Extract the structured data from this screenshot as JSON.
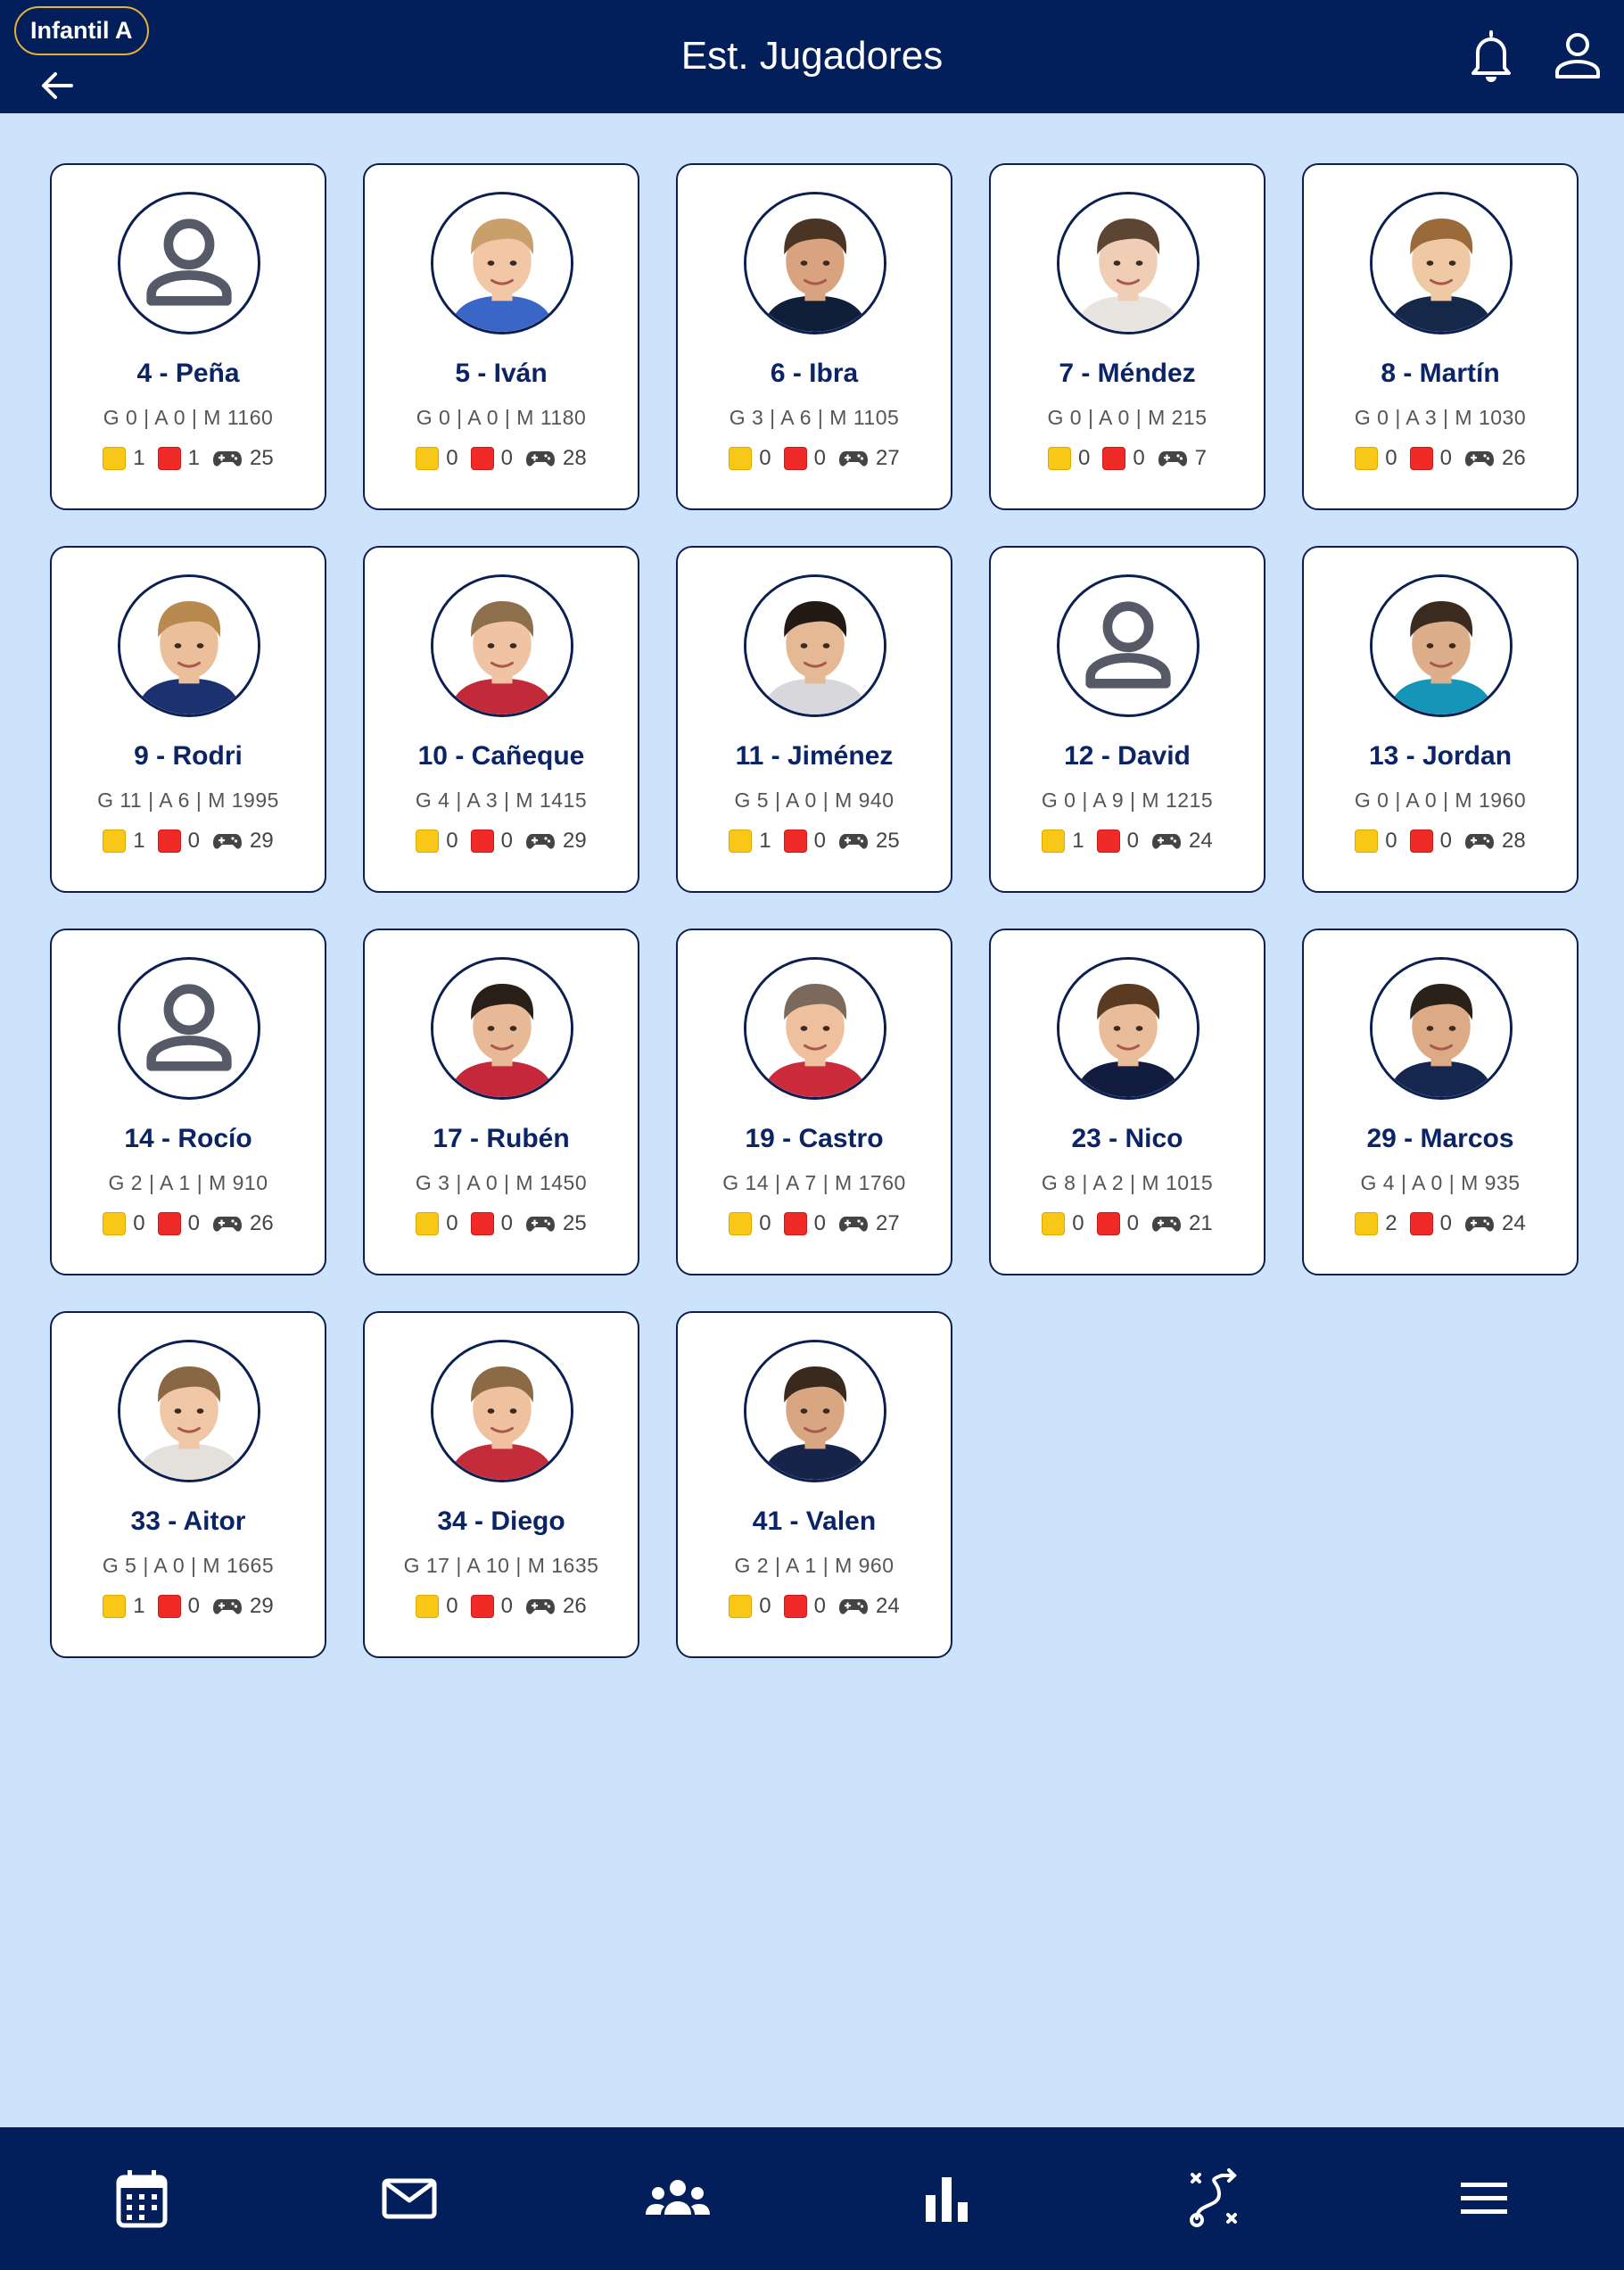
{
  "header": {
    "team_badge": "Infantil A",
    "title": "Est. Jugadores"
  },
  "icons": {
    "back": "arrow-left-icon",
    "notifications": "bell-icon",
    "profile": "user-icon",
    "yellow_card": "yellow-card-icon",
    "red_card": "red-card-icon",
    "matches": "gamepad-icon"
  },
  "colors": {
    "bar": "#021f5c",
    "background": "#cce3fb",
    "card_border": "#0b1f52",
    "name": "#0b2466",
    "badge_border": "#e6b22b",
    "yellow": "#f9c817",
    "red": "#ef2a27"
  },
  "players": [
    {
      "name": "4 - Peña",
      "stats": "G 0 | A 0 | M 1160",
      "yellow": "1",
      "red": "1",
      "matches": "25",
      "photo": false
    },
    {
      "name": "5 - Iván",
      "stats": "G 0 | A 0 | M 1180",
      "yellow": "0",
      "red": "0",
      "matches": "28",
      "photo": true,
      "skin": "#f1c7a6",
      "hair": "#c9a06a",
      "shirt": "#3a66c8"
    },
    {
      "name": "6 - Ibra",
      "stats": "G 3 | A 6 | M 1105",
      "yellow": "0",
      "red": "0",
      "matches": "27",
      "photo": true,
      "skin": "#d8a37e",
      "hair": "#4a3424",
      "shirt": "#0f1f3a"
    },
    {
      "name": "7 - Méndez",
      "stats": "G 0 | A 0 | M 215",
      "yellow": "0",
      "red": "0",
      "matches": "7",
      "photo": true,
      "skin": "#f0cdb5",
      "hair": "#5d4534",
      "shirt": "#e8e4e0"
    },
    {
      "name": "8 - Martín",
      "stats": "G 0 | A 3 | M 1030",
      "yellow": "0",
      "red": "0",
      "matches": "26",
      "photo": true,
      "skin": "#efc8a4",
      "hair": "#9b6a3a",
      "shirt": "#16284a"
    },
    {
      "name": "9 - Rodri",
      "stats": "G 11 | A 6 | M 1995",
      "yellow": "1",
      "red": "0",
      "matches": "29",
      "photo": true,
      "skin": "#ebbf9a",
      "hair": "#b98a4f",
      "shirt": "#1b3170"
    },
    {
      "name": "10 - Cañeque",
      "stats": "G 4 | A 3 | M 1415",
      "yellow": "0",
      "red": "0",
      "matches": "29",
      "photo": true,
      "skin": "#efc3a3",
      "hair": "#8e6f4d",
      "shirt": "#c22a3a"
    },
    {
      "name": "11 - Jiménez",
      "stats": "G 5 | A 0 | M 940",
      "yellow": "1",
      "red": "0",
      "matches": "25",
      "photo": true,
      "skin": "#e6b995",
      "hair": "#231a16",
      "shirt": "#d8d8dc"
    },
    {
      "name": "12 - David",
      "stats": "G 0 | A 9 | M 1215",
      "yellow": "1",
      "red": "0",
      "matches": "24",
      "photo": false
    },
    {
      "name": "13 - Jordan",
      "stats": "G 0 | A 0 | M 1960",
      "yellow": "0",
      "red": "0",
      "matches": "28",
      "photo": true,
      "skin": "#dcae8a",
      "hair": "#3a2a1f",
      "shirt": "#1596b8"
    },
    {
      "name": "14 - Rocío",
      "stats": "G 2 | A 1 | M 910",
      "yellow": "0",
      "red": "0",
      "matches": "26",
      "photo": false
    },
    {
      "name": "17 - Rubén",
      "stats": "G 3 | A 0 | M 1450",
      "yellow": "0",
      "red": "0",
      "matches": "25",
      "photo": true,
      "skin": "#e8b996",
      "hair": "#2a1e19",
      "shirt": "#c4283a"
    },
    {
      "name": "19 - Castro",
      "stats": "G 14 | A 7 | M 1760",
      "yellow": "0",
      "red": "0",
      "matches": "27",
      "photo": true,
      "skin": "#efc09d",
      "hair": "#7b6a5b",
      "shirt": "#cc2b3b"
    },
    {
      "name": "23 - Nico",
      "stats": "G 8 | A 2 | M 1015",
      "yellow": "0",
      "red": "0",
      "matches": "21",
      "photo": true,
      "skin": "#e9bd9a",
      "hair": "#5a3b22",
      "shirt": "#111c3e"
    },
    {
      "name": "29 - Marcos",
      "stats": "G 4 | A 0 | M 935",
      "yellow": "2",
      "red": "0",
      "matches": "24",
      "photo": true,
      "skin": "#dcab86",
      "hair": "#2c2119",
      "shirt": "#15264f"
    },
    {
      "name": "33 - Aitor",
      "stats": "G 5 | A 0 | M 1665",
      "yellow": "1",
      "red": "0",
      "matches": "29",
      "photo": true,
      "skin": "#f0c7a6",
      "hair": "#8a6744",
      "shirt": "#e4e0dc"
    },
    {
      "name": "34 - Diego",
      "stats": "G 17 | A 10 | M 1635",
      "yellow": "0",
      "red": "0",
      "matches": "26",
      "photo": true,
      "skin": "#efc19f",
      "hair": "#8c6a45",
      "shirt": "#c42c3a"
    },
    {
      "name": "41 - Valen",
      "stats": "G 2 | A 1 | M 960",
      "yellow": "0",
      "red": "0",
      "matches": "24",
      "photo": true,
      "skin": "#d9a682",
      "hair": "#3a291d",
      "shirt": "#16244a"
    }
  ],
  "bottom_nav": [
    {
      "icon": "calendar-icon"
    },
    {
      "icon": "mail-icon"
    },
    {
      "icon": "group-icon"
    },
    {
      "icon": "bar-chart-icon"
    },
    {
      "icon": "tactics-icon"
    },
    {
      "icon": "menu-icon"
    }
  ]
}
